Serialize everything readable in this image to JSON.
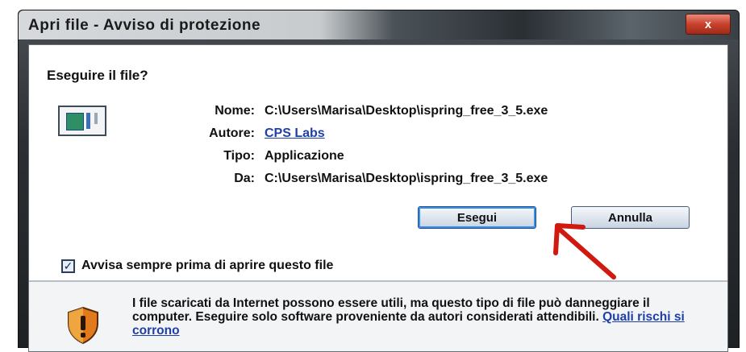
{
  "window": {
    "title": "Apri file - Avviso di protezione",
    "close_label": "x"
  },
  "dialog": {
    "heading": "Eseguire il file?",
    "file_icon": "application-window-icon",
    "fields": [
      {
        "label": "Nome:",
        "value": "C:\\Users\\Marisa\\Desktop\\ispring_free_3_5.exe",
        "is_link": false
      },
      {
        "label": "Autore:",
        "value": "CPS Labs",
        "is_link": true
      },
      {
        "label": "Tipo:",
        "value": "Applicazione",
        "is_link": false
      },
      {
        "label": "Da:",
        "value": "C:\\Users\\Marisa\\Desktop\\ispring_free_3_5.exe",
        "is_link": false
      }
    ],
    "buttons": {
      "run": "Esegui",
      "cancel": "Annulla"
    },
    "checkbox": {
      "label": "Avvisa sempre prima di aprire questo file",
      "checked": true
    },
    "warning": {
      "icon": "shield-warning-icon",
      "text": "I file scaricati da Internet possono essere utili, ma questo tipo di file può danneggiare il computer. Eseguire solo software proveniente da autori considerati attendibili.",
      "link": "Quali rischi si corrono"
    },
    "annotation": {
      "icon": "red-arrow-icon",
      "color": "#d01a10"
    }
  }
}
